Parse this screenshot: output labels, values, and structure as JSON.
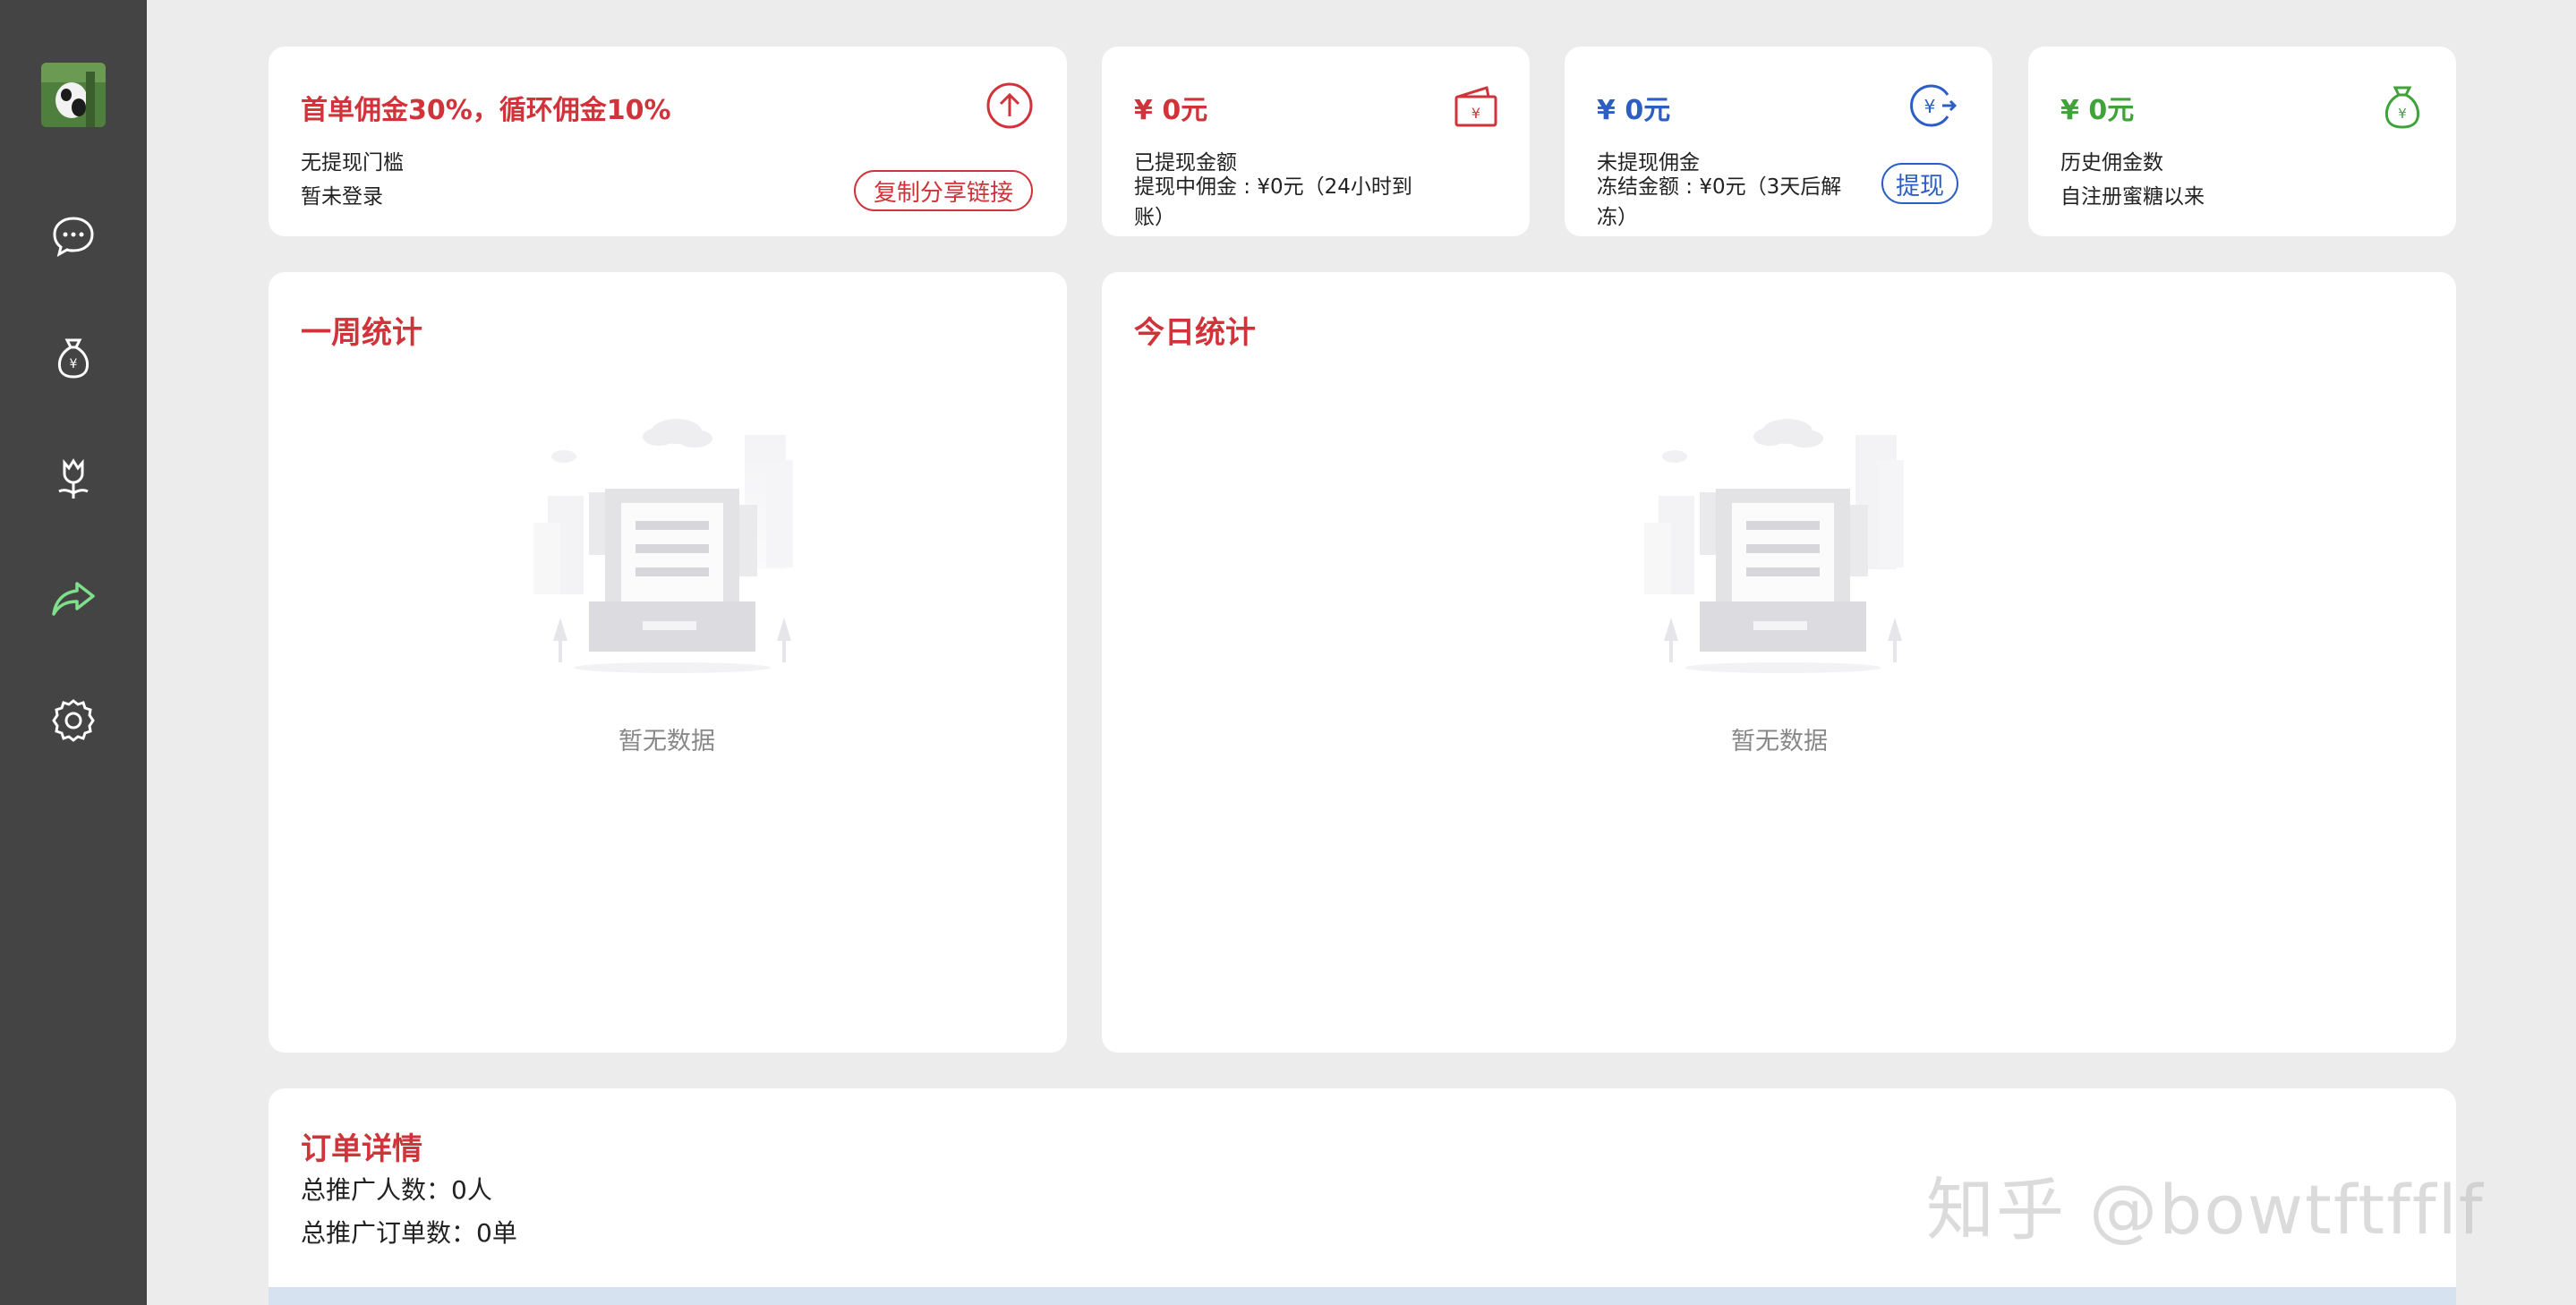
{
  "sidebar": {
    "nav": [
      {
        "name": "chat-icon",
        "active": false
      },
      {
        "name": "money-bag-icon",
        "active": false
      },
      {
        "name": "tulip-icon",
        "active": false
      },
      {
        "name": "share-arrow-icon",
        "active": true
      },
      {
        "name": "gear-icon",
        "active": false
      }
    ]
  },
  "promo_card": {
    "title": "首单佣金30%，循环佣金10%",
    "line1": "无提现门槛",
    "line2": "暂未登录",
    "copy_button": "复制分享链接",
    "icon": "arrow-up-circle-icon"
  },
  "withdrawn_card": {
    "amount": "¥ 0元",
    "line1": "已提现金额",
    "line2": "提现中佣金 : ¥0元（24小时到账）",
    "icon": "wallet-icon"
  },
  "pending_card": {
    "amount": "¥ 0元",
    "line1": "未提现佣金",
    "line2": "冻结金额 : ¥0元（3天后解冻）",
    "withdraw_button": "提现",
    "icon": "yuan-exchange-icon"
  },
  "history_card": {
    "amount": "¥ 0元",
    "line1": "历史佣金数",
    "line2": "自注册蜜糖以来",
    "icon": "money-bag-icon"
  },
  "weekly_stats": {
    "title": "一周统计",
    "empty_text": "暂无数据"
  },
  "daily_stats": {
    "title": "今日统计",
    "empty_text": "暂无数据"
  },
  "order_details": {
    "title": "订单详情",
    "total_promoters": "总推广人数：0人",
    "total_orders": "总推广订单数：0单"
  },
  "watermark": "知乎 @bowtftfflf",
  "colors": {
    "sidebar_bg": "#444444",
    "page_bg": "#ececec",
    "accent_red": "#d1333a",
    "blue": "#2c5ec4",
    "green": "#3fa33a",
    "active_nav": "#7ee08a"
  }
}
